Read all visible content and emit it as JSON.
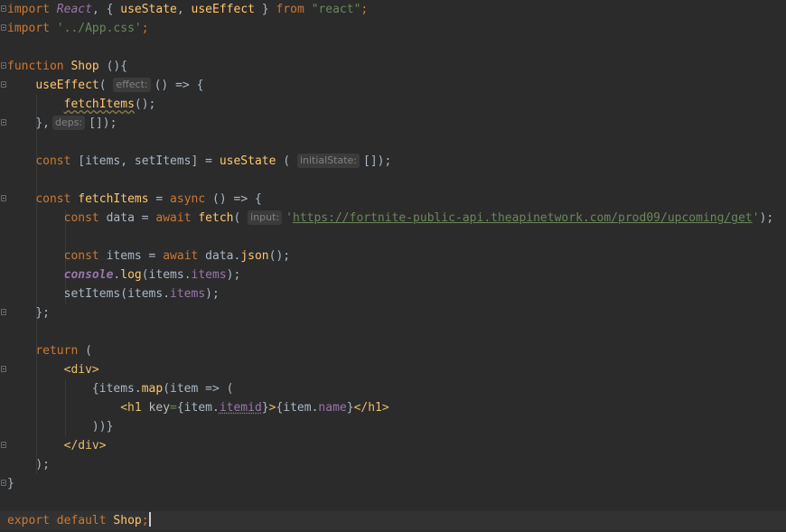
{
  "editor": {
    "language": "javascript-jsx",
    "colors": {
      "background": "#2b2b2b",
      "keyword": "#cc7832",
      "function": "#ffc66d",
      "string": "#6a8759",
      "property": "#9876aa",
      "text": "#a9b7c6",
      "hint_bg": "#3b3b3b"
    },
    "code": {
      "l1": {
        "import": "import",
        "react": "React",
        "p1": ", { ",
        "useState": "useState",
        "comma": ", ",
        "useEffect": "useEffect",
        "p2": " } ",
        "from": "from",
        "sp": " ",
        "module": "\"react\"",
        "semi": ";"
      },
      "l2": {
        "import": "import",
        "sp": " ",
        "path": "'../App.css'",
        "semi": ";"
      },
      "l4": {
        "function": "function",
        "sp": " ",
        "name": "Shop",
        "rest": " (){"
      },
      "l5": {
        "indent": "    ",
        "call": "useEffect",
        "open": "( ",
        "hint": "effect:",
        "rest": "() => {"
      },
      "l6": {
        "indent": "        ",
        "call": "fetchItems",
        "rest": "();"
      },
      "l7": {
        "indent": "    ",
        "start": "},",
        "hint": "deps:",
        "rest": "[]);"
      },
      "l9": {
        "indent": "    ",
        "const": "const",
        "p1": " [items, setItems] = ",
        "call": "useState",
        "p2": " ( ",
        "hint": "initialState:",
        "rest": "[]);"
      },
      "l11": {
        "indent": "    ",
        "const": "const",
        "sp": " ",
        "name": "fetchItems",
        "p1": " = ",
        "async": "async",
        "rest": " () => {"
      },
      "l12": {
        "indent": "        ",
        "const": "const",
        "p1": " data = ",
        "await": "await",
        "sp": " ",
        "call": "fetch",
        "open": "( ",
        "hint": "input:",
        "q1": "'",
        "url": "https://fortnite-public-api.theapinetwork.com/prod09/upcoming/get",
        "q2": "'",
        "rest": ");"
      },
      "l14": {
        "indent": "        ",
        "const": "const",
        "p1": " items = ",
        "await": "await",
        "p2": " data.",
        "call": "json",
        "rest": "();"
      },
      "l15": {
        "indent": "        ",
        "console": "console",
        "dot": ".",
        "call": "log",
        "p1": "(items.",
        "prop": "items",
        "rest": ");"
      },
      "l16": {
        "indent": "        ",
        "p1": "setItems(items.",
        "prop": "items",
        "rest": ");"
      },
      "l17": {
        "indent": "    ",
        "text": "};"
      },
      "l19": {
        "indent": "    ",
        "return": "return",
        "rest": " ("
      },
      "l20": {
        "indent": "        ",
        "tag": "<div>"
      },
      "l21": {
        "indent": "            ",
        "p1": "{items.",
        "call": "map",
        "rest": "(item => ("
      },
      "l22": {
        "indent": "                ",
        "tagOpen": "<h1 ",
        "attr": "key",
        "eq": "=",
        "p1": "{item.",
        "prop1": "itemid",
        "p2": "}",
        "gt": ">",
        "p3": "{item.",
        "prop2": "name",
        "p4": "}",
        "tagClose": "</h1>"
      },
      "l23": {
        "indent": "            ",
        "text": "))}"
      },
      "l24": {
        "indent": "        ",
        "tag": "</div>"
      },
      "l25": {
        "indent": "    ",
        "text": ");"
      },
      "l26": {
        "text": "}"
      },
      "l28": {
        "export": "export",
        "sp1": " ",
        "default": "default",
        "sp2": " ",
        "name": "Shop",
        "semi": ";"
      }
    }
  }
}
